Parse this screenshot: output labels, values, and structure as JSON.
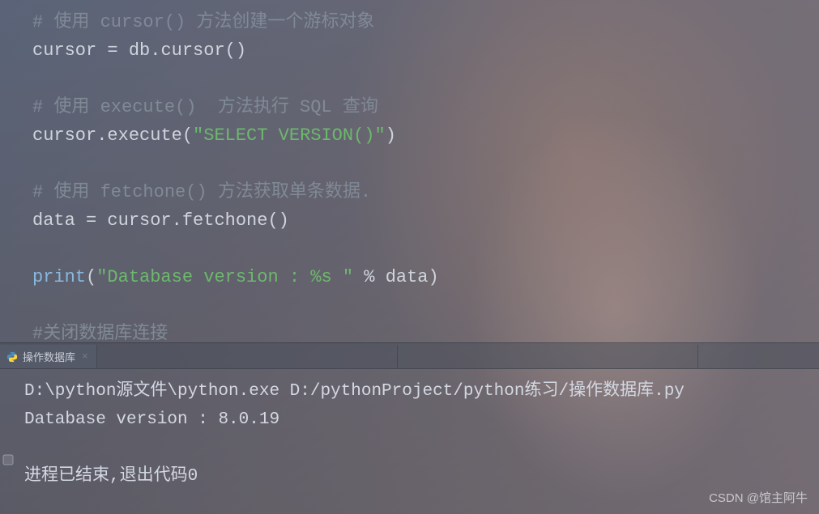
{
  "editor": {
    "lines": [
      {
        "type": "comment",
        "segments": [
          {
            "cls": "tok-comment",
            "text": "# 使用 cursor() 方法创建一个游标对象"
          }
        ]
      },
      {
        "type": "code",
        "segments": [
          {
            "cls": "tok-identifier",
            "text": "cursor "
          },
          {
            "cls": "tok-operator",
            "text": "= "
          },
          {
            "cls": "tok-identifier",
            "text": "db"
          },
          {
            "cls": "tok-punct",
            "text": "."
          },
          {
            "cls": "tok-identifier",
            "text": "cursor"
          },
          {
            "cls": "tok-punct",
            "text": "()"
          }
        ]
      },
      {
        "type": "blank",
        "segments": []
      },
      {
        "type": "comment",
        "segments": [
          {
            "cls": "tok-comment",
            "text": "# 使用 execute()  方法执行 SQL 查询"
          }
        ]
      },
      {
        "type": "code",
        "segments": [
          {
            "cls": "tok-identifier",
            "text": "cursor"
          },
          {
            "cls": "tok-punct",
            "text": "."
          },
          {
            "cls": "tok-identifier",
            "text": "execute"
          },
          {
            "cls": "tok-punct",
            "text": "("
          },
          {
            "cls": "tok-string",
            "text": "\"SELECT VERSION()\""
          },
          {
            "cls": "tok-punct",
            "text": ")"
          }
        ]
      },
      {
        "type": "blank",
        "segments": []
      },
      {
        "type": "comment",
        "segments": [
          {
            "cls": "tok-comment",
            "text": "# 使用 fetchone() 方法获取单条数据."
          }
        ]
      },
      {
        "type": "code",
        "segments": [
          {
            "cls": "tok-identifier",
            "text": "data "
          },
          {
            "cls": "tok-operator",
            "text": "= "
          },
          {
            "cls": "tok-identifier",
            "text": "cursor"
          },
          {
            "cls": "tok-punct",
            "text": "."
          },
          {
            "cls": "tok-identifier",
            "text": "fetchone"
          },
          {
            "cls": "tok-punct",
            "text": "()"
          }
        ]
      },
      {
        "type": "blank",
        "segments": []
      },
      {
        "type": "code",
        "segments": [
          {
            "cls": "tok-builtin",
            "text": "print"
          },
          {
            "cls": "tok-punct",
            "text": "("
          },
          {
            "cls": "tok-string",
            "text": "\"Database version : %s \""
          },
          {
            "cls": "tok-operator",
            "text": " % "
          },
          {
            "cls": "tok-identifier",
            "text": "data"
          },
          {
            "cls": "tok-punct",
            "text": ")"
          }
        ]
      },
      {
        "type": "blank",
        "segments": []
      },
      {
        "type": "comment",
        "wave": true,
        "segments": [
          {
            "cls": "tok-comment",
            "text": "#关闭数据库连接"
          }
        ]
      }
    ]
  },
  "tab": {
    "label": "操作数据库",
    "icon_name": "python-icon"
  },
  "console": {
    "lines": [
      "D:\\python源文件\\python.exe D:/pythonProject/python练习/操作数据库.py",
      "Database version : 8.0.19",
      "",
      "进程已结束,退出代码0"
    ]
  },
  "watermark": "CSDN @馆主阿牛"
}
